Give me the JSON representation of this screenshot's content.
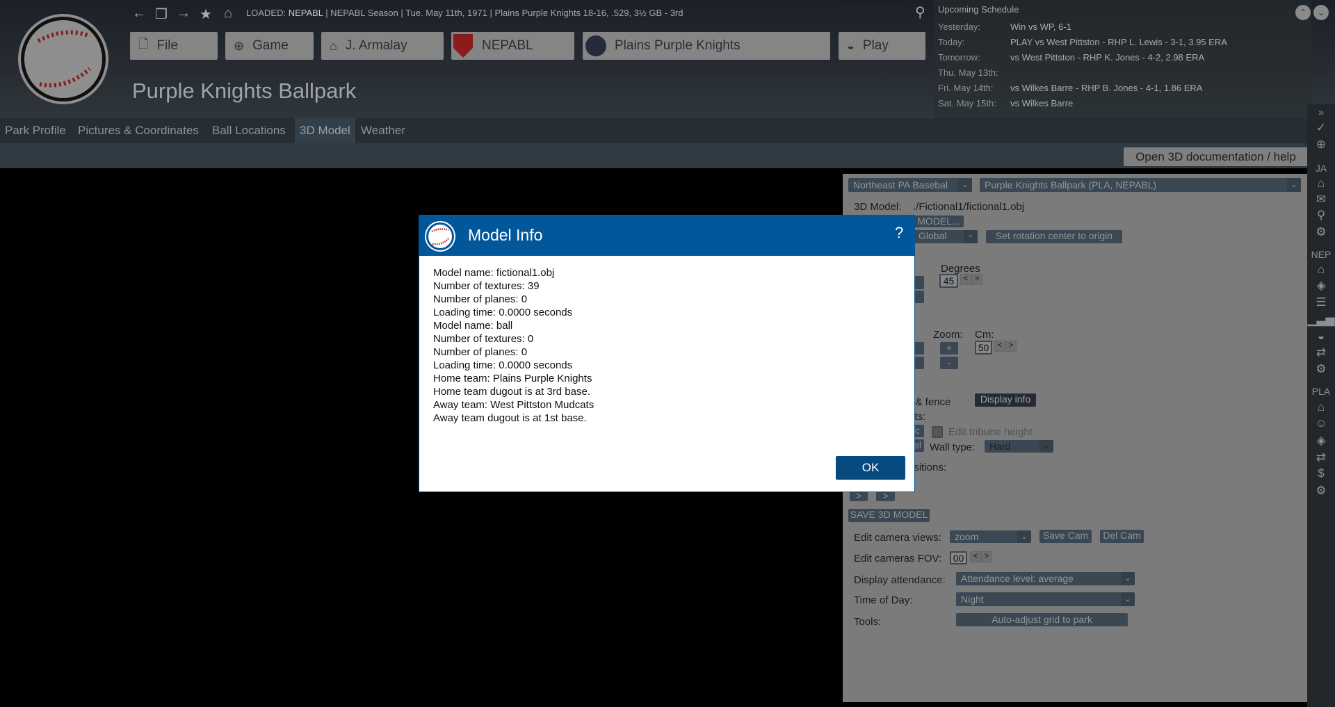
{
  "header": {
    "status_loaded": "LOADED:",
    "status_league": "NEPABL",
    "status_rest": "| NEPABL Season | Tue. May 11th, 1971 | Plains Purple Knights  18-16, .529, 3½ GB - 3rd",
    "page_title": "Purple Knights Ballpark",
    "menu": [
      {
        "label": "File",
        "icon": "file-icon"
      },
      {
        "label": "Game",
        "icon": "globe-icon"
      },
      {
        "label": "J. Armalay",
        "icon": "home-icon"
      },
      {
        "label": "NEPABL",
        "icon": "league-logo"
      },
      {
        "label": "Plains Purple Knights",
        "icon": "team-logo"
      },
      {
        "label": "Play",
        "icon": "baseball-icon"
      }
    ]
  },
  "schedule": {
    "title": "Upcoming Schedule",
    "rows": [
      {
        "day": "Yesterday:",
        "text": "Win vs WP, 6-1"
      },
      {
        "day": "Today:",
        "text": "PLAY vs West Pittston - RHP L. Lewis - 3-1, 3.95 ERA"
      },
      {
        "day": "Tomorrow:",
        "text": "vs West Pittston - RHP K. Jones - 4-2, 2.98 ERA"
      },
      {
        "day": "Thu. May 13th:",
        "text": ""
      },
      {
        "day": "Fri. May 14th:",
        "text": "vs Wilkes Barre - RHP B. Jones - 4-1, 1.86 ERA"
      },
      {
        "day": "Sat. May 15th:",
        "text": "vs Wilkes Barre"
      }
    ]
  },
  "tabs": [
    "Park Profile",
    "Pictures & Coordinates",
    "Ball Locations",
    "3D Model",
    "Weather"
  ],
  "active_tab": "3D Model",
  "doc_button": "Open 3D documentation / help",
  "panel": {
    "league_select": "Northeast PA Basebal",
    "park_select": "Purple Knights Ballpark (PLA, NEPABL)",
    "model_label": "3D Model:",
    "model_path": "./Fictional1/fictional1.obj",
    "load_model_btn": "MODEL...",
    "space_select": "Global",
    "rotation_btn": "Set rotation center to origin",
    "degrees_label": "Degrees",
    "degrees_value": "45",
    "zoom_label": "Zoom:",
    "cm_label": "Cm:",
    "cm_value": "50",
    "zoom_plus": "+",
    "zoom_minus": "-",
    "fence_text": "d & fence",
    "display_info_btn": "Display info",
    "sts_text": "sts:",
    "peek_c": "c",
    "peek_el": "el",
    "tribune_label": "Edit tribune height",
    "wall_label": "Wall type:",
    "wall_value": "Hard",
    "positions_text": "ositions:",
    "save_model_btn": "SAVE 3D MODEL",
    "camera_label": "Edit camera views:",
    "camera_value": "zoom",
    "save_cam": "Save Cam",
    "del_cam": "Del Cam",
    "fov_label": "Edit cameras FOV:",
    "fov_value": "00",
    "attendance_label": "Display attendance:",
    "attendance_value": "Attendance level: average",
    "time_label": "Time of Day:",
    "time_value": "Night",
    "tools_label": "Tools:",
    "tools_btn": "Auto-adjust grid to park"
  },
  "sidebar": {
    "sections": [
      "JA",
      "NEP",
      "PLA"
    ]
  },
  "dialog": {
    "title": "Model Info",
    "help": "?",
    "lines": [
      "Model name: fictional1.obj",
      "Number of textures: 39",
      "Number of planes: 0",
      "Loading time: 0.0000 seconds",
      "Model name: ball",
      "Number of textures: 0",
      "Number of planes: 0",
      "Loading time: 0.0000 seconds",
      "Home team: Plains Purple Knights",
      "Home team dugout is at 3rd base.",
      "Away team: West Pittston Mudcats",
      "Away team dugout is at 1st base."
    ],
    "ok": "OK"
  },
  "colors": {
    "dialog_header": "#02579b",
    "ok_button": "#064a80",
    "panel": "#7b7b7b"
  }
}
